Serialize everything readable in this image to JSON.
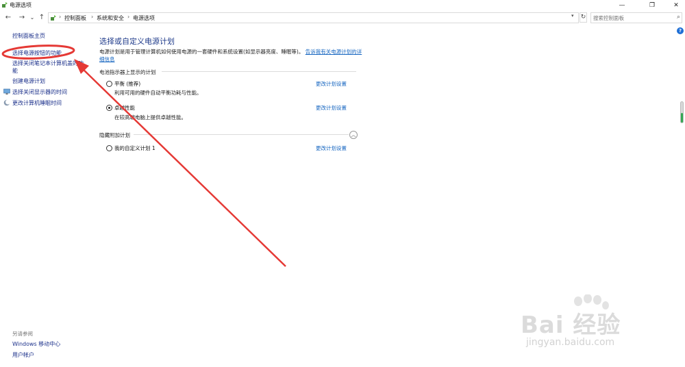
{
  "window": {
    "title": "电源选项",
    "controls": {
      "minimize": "—",
      "maximize": "❐",
      "close": "✕"
    }
  },
  "address_bar": {
    "back": "←",
    "forward": "→",
    "history": "⌄",
    "up": "↑",
    "breadcrumbs": [
      "控制面板",
      "系统和安全",
      "电源选项"
    ],
    "separator": "›",
    "refresh": "↻",
    "search_placeholder": "搜索控制面板"
  },
  "help_label": "?",
  "sidebar": {
    "home": "控制面板主页",
    "items": [
      {
        "label": "选择电源按钮的功能",
        "icon": null
      },
      {
        "label": "选择关闭笔记本计算机盖的功",
        "label2": "能",
        "icon": null
      },
      {
        "label": "创建电源计划",
        "icon": null
      },
      {
        "label": "选择关闭显示器的时间",
        "icon": "monitor-icon"
      },
      {
        "label": "更改计算机睡眠时间",
        "icon": "moon-icon"
      }
    ]
  },
  "main": {
    "heading": "选择或自定义电源计划",
    "description": "电源计划是用于管理计算机如何使用电源的一套硬件和系统设置(如显示器亮度、睡眠等)。",
    "description_link": "告诉我有关电源计划的详细信息",
    "battery_group": "电池指示器上显示的计划",
    "plans": [
      {
        "name": "平衡 (推荐)",
        "desc": "利用可用的硬件自动平衡功耗与性能。",
        "selected": false,
        "change": "更改计划设置"
      },
      {
        "name": "卓越性能",
        "desc": "在较高端电脑上提供卓越性能。",
        "selected": true,
        "change": "更改计划设置"
      }
    ],
    "hidden_group": "隐藏附加计划",
    "hidden_plans": [
      {
        "name": "我的自定义计划 1",
        "selected": false,
        "change": "更改计划设置"
      }
    ]
  },
  "see_also": {
    "title": "另请参阅",
    "links": [
      "Windows 移动中心",
      "用户帐户"
    ]
  },
  "watermark": {
    "main": "Bai 经验",
    "sub": "jingyan.baidu.com"
  },
  "colors": {
    "link": "#1565c0",
    "heading": "#1e3a8a",
    "annotation": "#e53935"
  }
}
